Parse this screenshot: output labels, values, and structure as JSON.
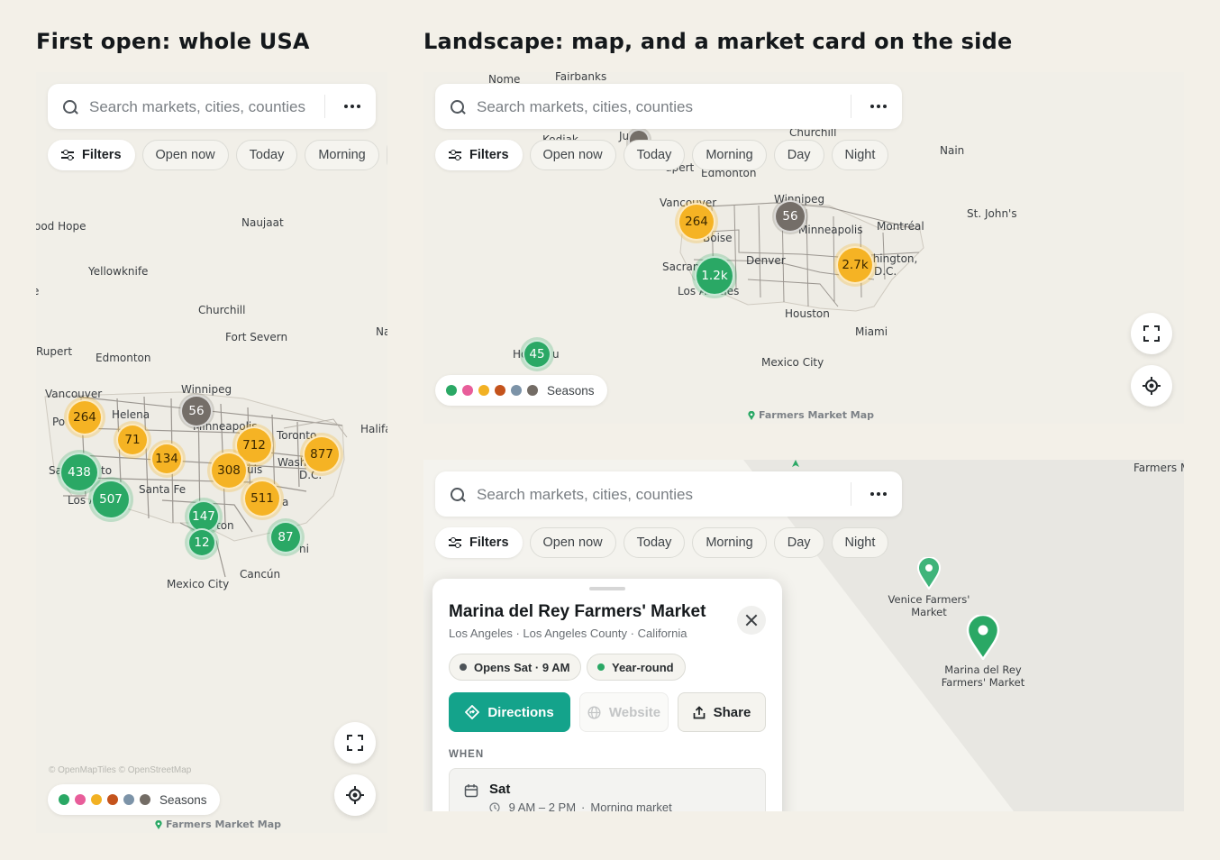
{
  "headings": {
    "left": "First open: whole USA",
    "right": "Landscape: map, and a market card on the side"
  },
  "search": {
    "placeholder": "Search markets, cities, counties"
  },
  "chips": {
    "filters": "Filters",
    "open_now": "Open now",
    "today": "Today",
    "morning": "Morning",
    "day": "Day",
    "night": "Night"
  },
  "legend": {
    "label": "Seasons",
    "colors": [
      "#2aa865",
      "#e85d9a",
      "#f2b123",
      "#c4531c",
      "#7c93a8",
      "#736c65"
    ]
  },
  "brand": "Farmers Market Map",
  "attribution": "© OpenMapTiles © OpenStreetMap",
  "panel_a": {
    "places": [
      "ood Hope",
      "Naujaat",
      "Yellowknife",
      "e",
      "Churchill",
      "Fort Severn",
      "Na",
      "Rupert",
      "Edmonton",
      "Winnipeg",
      "Vancouver",
      "Helena",
      "Po",
      "Minneapolis",
      "Toronto",
      "Halifa",
      "Sa",
      "to",
      "L",
      "uis",
      "Wash",
      "D.C.",
      "Los A",
      "Santa Fe",
      "a",
      "ton",
      "ni",
      "Mexico City",
      "Cancún"
    ],
    "clusters": [
      "264",
      "56",
      "71",
      "134",
      "712",
      "877",
      "308",
      "438",
      "507",
      "511",
      "147",
      "12",
      "87"
    ]
  },
  "panel_b": {
    "places": [
      "Nome",
      "Fairbanks",
      "Churchill",
      "Nain",
      "Kodiak",
      "Ju",
      "upert",
      "Edmonton",
      "Vancouver",
      "Winnipeg",
      "Boise",
      "Minneapolis",
      "Montréal",
      "St. John's",
      "Sacram",
      "Denver",
      "Washington,",
      "D.C.",
      "Los An",
      "eles",
      "Houston",
      "Miami",
      "Mexico City",
      "Ho",
      "u"
    ],
    "clusters": [
      "264",
      "56",
      "2.7k",
      "1.2k",
      "45"
    ]
  },
  "panel_c": {
    "places": [
      "Farmers M",
      "Venice Farmers' Market",
      "Marina del Rey Farmers' Market"
    ]
  },
  "card": {
    "title": "Marina del Rey Farmers' Market",
    "subtitle": "Los Angeles · Los Angeles County · California",
    "badge_open": "Opens Sat · 9 AM",
    "badge_season": "Year-round",
    "directions": "Directions",
    "website": "Website",
    "share": "Share",
    "section_when": "WHEN",
    "when_day": "Sat",
    "when_time": "9 AM – 2 PM",
    "when_note": "Morning market"
  }
}
